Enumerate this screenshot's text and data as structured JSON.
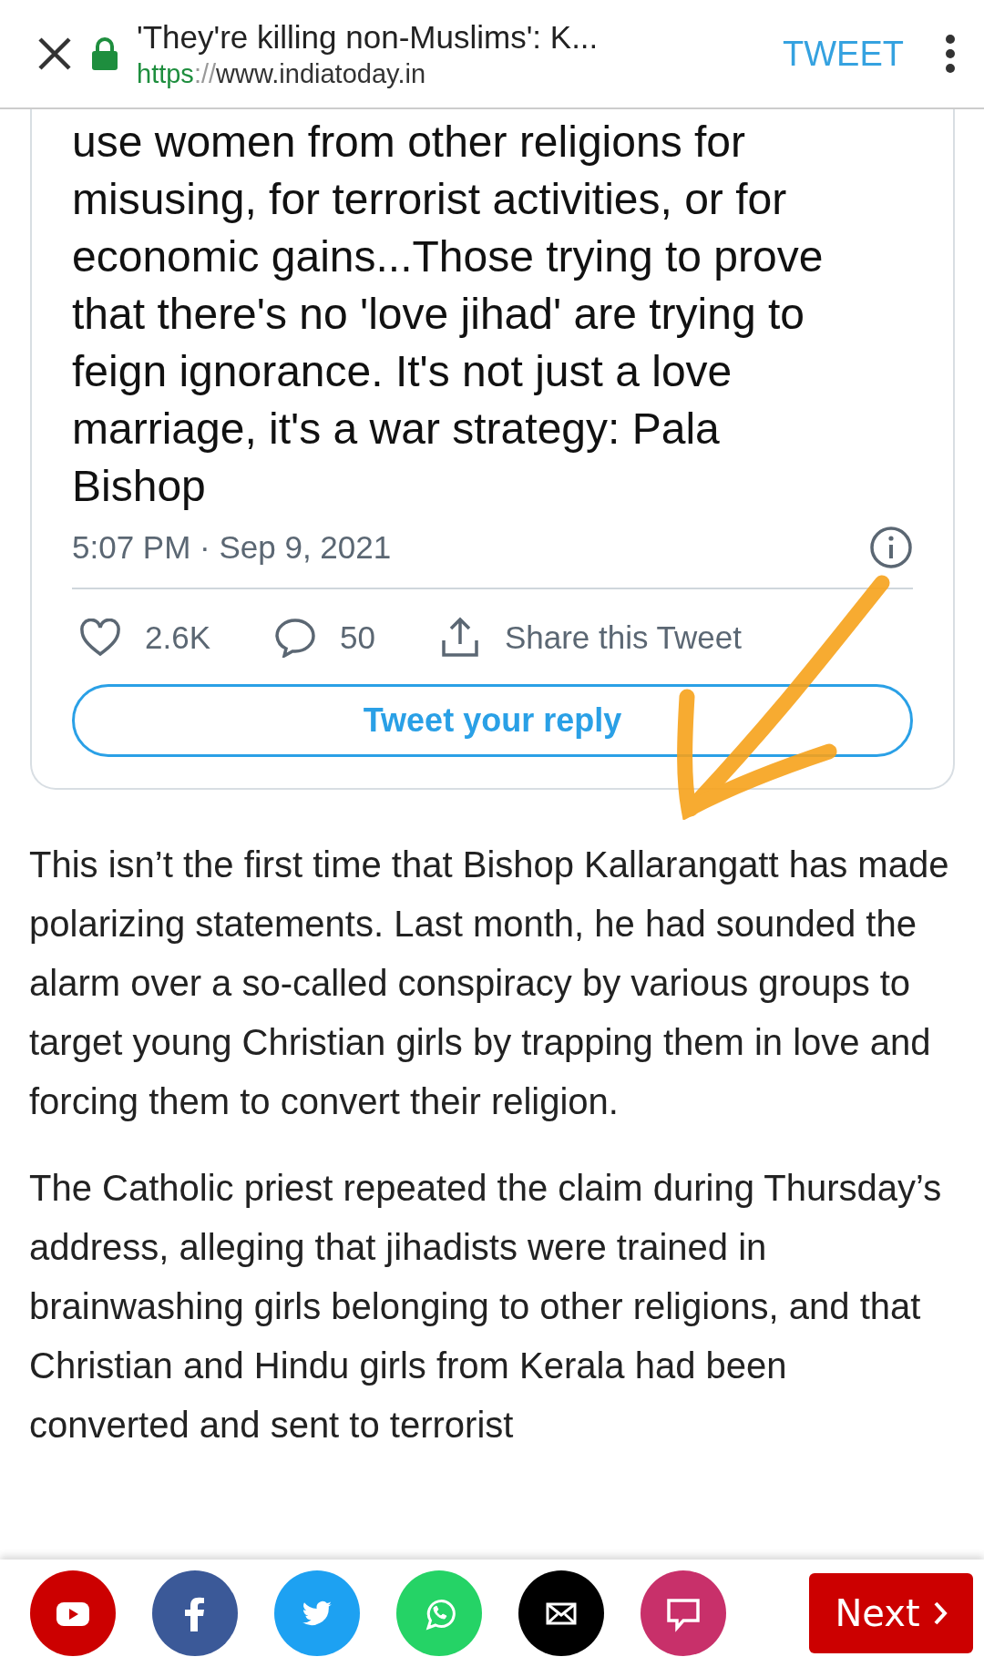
{
  "browser_bar": {
    "title": "'They're killing non-Muslims': K...",
    "url_scheme": "https",
    "url_separator": "://",
    "url_host": "www.indiatoday.in",
    "action": "TWEET"
  },
  "tweet": {
    "text": "use women from other religions for misusing, for terrorist activities, or for economic gains...Those trying to prove that there's no 'love jihad' are trying to feign ignorance. It's not just a love marriage, it's a war strategy: Pala Bishop",
    "time": "5:07 PM · Sep 9, 2021",
    "likes": "2.6K",
    "replies": "50",
    "share": "Share this Tweet",
    "reply_button": "Tweet your reply"
  },
  "paragraphs": [
    "This isn’t the first time that Bishop Kallarangatt has made polarizing statements. Last month, he had sounded the alarm over a so-called conspiracy by various groups to target young Christian girls by trapping them in love and forcing them to convert their religion.",
    "The Catholic priest repeated the claim during Thursday’s address, alleging that jihadists were trained in brainwashing girls belonging to other religions, and that Christian and Hindu girls from Kerala had been converted and sent to terrorist"
  ],
  "share_bar": {
    "buttons": [
      {
        "kind": "youtube",
        "color": "#cc0000"
      },
      {
        "kind": "facebook",
        "color": "#3b5998"
      },
      {
        "kind": "twitter",
        "color": "#1da1f2"
      },
      {
        "kind": "whatsapp",
        "color": "#25d366"
      },
      {
        "kind": "email",
        "color": "#000000"
      },
      {
        "kind": "comment",
        "color": "#c8306a"
      }
    ],
    "next": "Next"
  }
}
